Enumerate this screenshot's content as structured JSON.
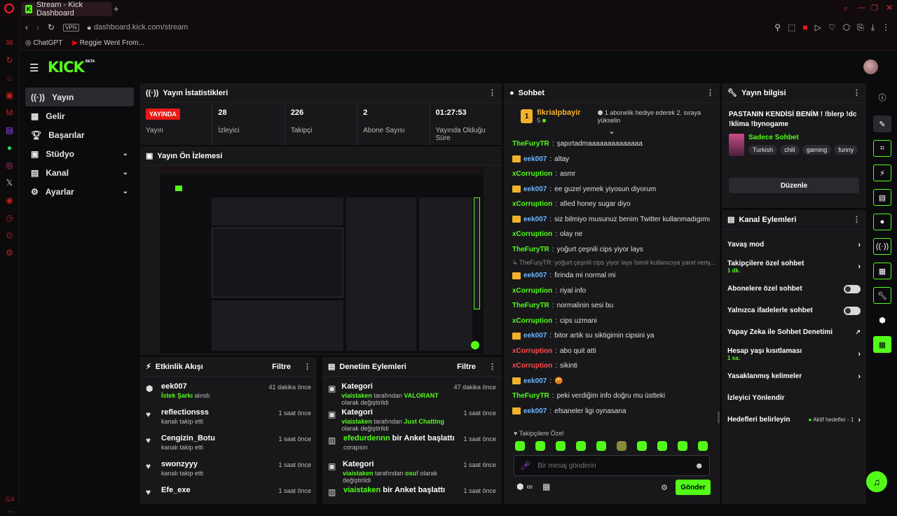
{
  "browser": {
    "tab_title": "Stream - Kick Dashboard",
    "vpn": "VPN",
    "url": "dashboard.kick.com/stream",
    "bookmarks": [
      "ChatGPT",
      "Reggie Went From..."
    ]
  },
  "header": {
    "logo": "KICK",
    "beta": "BETA"
  },
  "sidebar": {
    "items": [
      {
        "label": "Yayın",
        "icon": "broadcast-icon"
      },
      {
        "label": "Gelir",
        "icon": "revenue-icon"
      },
      {
        "label": "Başarılar",
        "icon": "trophy-icon"
      },
      {
        "label": "Stüdyo",
        "icon": "studio-icon"
      },
      {
        "label": "Kanal",
        "icon": "channel-icon"
      },
      {
        "label": "Ayarlar",
        "icon": "gear-icon"
      }
    ]
  },
  "stats": {
    "title": "Yayın İstatistikleri",
    "live": "YAYINDA",
    "live_label": "Yayın",
    "items": [
      {
        "value": "28",
        "label": "İzleyici"
      },
      {
        "value": "226",
        "label": "Takipçi"
      },
      {
        "value": "2",
        "label": "Abone Sayısı"
      },
      {
        "value": "01:27:53",
        "label": "Yayında Olduğu Süre"
      }
    ]
  },
  "preview": {
    "title": "Yayın Ön İzlemesi"
  },
  "activity": {
    "title": "Etkinlik Akışı",
    "filter": "Filtre",
    "rows": [
      {
        "name": "eek007",
        "detail_a": "İstek Şarkı",
        "detail_b": " alındı",
        "time": "41 dakika önce"
      },
      {
        "name": "reflectionsss",
        "detail_a": "",
        "detail_b": "kanalı takip etti",
        "time": "1 saat önce"
      },
      {
        "name": "Cengizin_Botu",
        "detail_a": "",
        "detail_b": "kanalı takip etti",
        "time": "1 saat önce"
      },
      {
        "name": "swonzyyy",
        "detail_a": "",
        "detail_b": "kanalı takip etti",
        "time": "1 saat önce"
      },
      {
        "name": "Efe_exe",
        "detail_a": "",
        "detail_b": "",
        "time": "1 saat önce"
      }
    ]
  },
  "moderation": {
    "title": "Denetim Eylemleri",
    "filter": "Filtre",
    "rows": [
      {
        "title_a": "",
        "title_b": "Kategori",
        "user": "viaistaken",
        "mid": " tarafından ",
        "hl": "VALORANT",
        "tail": " olarak değiştirildi",
        "time": "47 dakika önce"
      },
      {
        "title_a": "",
        "title_b": "Kategori",
        "user": "viaistaken",
        "mid": " tarafından ",
        "hl": "Just Chatting",
        "tail": " olarak değiştirildi",
        "time": "1 saat önce"
      },
      {
        "title_a": "efedurdennn",
        "title_b": " bir Anket başlattı",
        "user": "",
        "mid": "",
        "hl": "",
        "tail": "corapsın",
        "time": "1 saat önce"
      },
      {
        "title_a": "",
        "title_b": "Kategori",
        "user": "viaistaken",
        "mid": " tarafından ",
        "hl": "osu!",
        "tail": " olarak değiştirildi",
        "time": "1 saat önce"
      },
      {
        "title_a": "viaistaken",
        "title_b": " bir Anket başlattı",
        "user": "",
        "mid": "",
        "hl": "",
        "tail": "",
        "time": "1 saat önce"
      }
    ]
  },
  "chat": {
    "title": "Sohbet",
    "gift_user": "fikrialpbayir",
    "gift_count": "5",
    "gift_text": "1 abonelik hediye ederek 2. sıraya yükselin",
    "messages": [
      {
        "user": "TheFuryTR",
        "color": "green",
        "crown": false,
        "text": "şapırtadmaaaaaaaaaaaaaa"
      },
      {
        "user": "eek007",
        "color": "blue",
        "crown": true,
        "text": "altay"
      },
      {
        "user": "xCorruption",
        "color": "green",
        "crown": false,
        "text": "asmr"
      },
      {
        "user": "eek007",
        "color": "blue",
        "crown": true,
        "text": "ee guzel yemek yiyosun diyorum"
      },
      {
        "user": "xCorruption",
        "color": "green",
        "crown": false,
        "text": "afied honey sugar diyo"
      },
      {
        "user": "eek007",
        "color": "blue",
        "crown": true,
        "text": "siz bilmiyo musunuz benim Twitter kullanmadıgımı"
      },
      {
        "user": "xCorruption",
        "color": "green",
        "crown": false,
        "text": "olay ne"
      },
      {
        "user": "TheFuryTR",
        "color": "green",
        "crown": false,
        "text": "yoğurt çeşnili cips yiyor lays"
      },
      {
        "user": "",
        "color": "reply",
        "crown": false,
        "text": "↳ TheFuryTR: yoğurt çeşnili cips yiyor lays İsimli kullanıcıya yanıt veriy..."
      },
      {
        "user": "eek007",
        "color": "blue",
        "crown": true,
        "text": "firinda mi normal mi"
      },
      {
        "user": "xCorruption",
        "color": "green",
        "crown": false,
        "text": "riyal info"
      },
      {
        "user": "TheFuryTR",
        "color": "green",
        "crown": false,
        "text": "normalinin sesi bu"
      },
      {
        "user": "xCorruption",
        "color": "green",
        "crown": false,
        "text": "cips uzmani"
      },
      {
        "user": "eek007",
        "color": "blue",
        "crown": true,
        "text": "bitor artik su siktigimin cipsini ya"
      },
      {
        "user": "xCorruption",
        "color": "red",
        "crown": false,
        "text": "abo quit atti"
      },
      {
        "user": "xCorruption",
        "color": "red",
        "crown": false,
        "text": "sikinti"
      },
      {
        "user": "eek007",
        "color": "blue",
        "crown": true,
        "text": "😡"
      },
      {
        "user": "TheFuryTR",
        "color": "green",
        "crown": false,
        "text": "peki verdiğim info doğru mu üstteki"
      },
      {
        "user": "eek007",
        "color": "blue",
        "crown": true,
        "text": "efsaneler ligi oynasana"
      }
    ],
    "followers_only": "Takipçilere Özel",
    "input_placeholder": "Bir mesaj gönderin",
    "send": "Gönder"
  },
  "info": {
    "title": "Yayın bilgisi",
    "stream_title": "PASTANIN KENDİSİ BENİM ! !blerp !dc !klima !bynogame",
    "category": "Sadece Sohbet",
    "tags": [
      "Turkish",
      "chill",
      "gaming",
      "funny"
    ],
    "edit": "Düzenle"
  },
  "channel_actions": {
    "title": "Kanal Eylemleri",
    "rows": [
      {
        "label": "Yavaş mod",
        "sub": "",
        "type": "chevron",
        "extra": ""
      },
      {
        "label": "Takipçilere özel sohbet",
        "sub": "1 dk.",
        "type": "chevron",
        "extra": ""
      },
      {
        "label": "Abonelere özel sohbet",
        "sub": "",
        "type": "toggle",
        "extra": ""
      },
      {
        "label": "Yalnızca ifadelerle sohbet",
        "sub": "",
        "type": "toggle",
        "extra": ""
      },
      {
        "label": "Yapay Zeka ile Sohbet Denetimi",
        "sub": "",
        "type": "external",
        "extra": ""
      },
      {
        "label": "Hesap yaşı kısıtlaması",
        "sub": "1 sa.",
        "type": "chevron",
        "extra": ""
      },
      {
        "label": "Yasaklanmış kelimeler",
        "sub": "",
        "type": "chevron",
        "extra": ""
      },
      {
        "label": "İzleyici Yönlendir",
        "sub": "",
        "type": "none",
        "extra": ""
      },
      {
        "label": "Hedefleri belirleyin",
        "sub": "",
        "type": "chevron",
        "extra": "Aktif hedefler - 1"
      }
    ]
  },
  "colors": {
    "accent": "#53fc18",
    "live": "#e91916",
    "panel": "#18181b",
    "bg": "#0b0b0d"
  }
}
